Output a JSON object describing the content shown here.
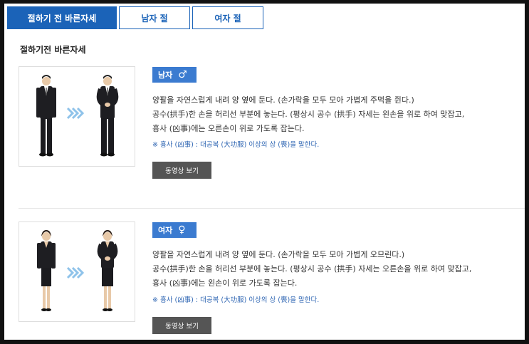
{
  "tabs": [
    {
      "label": "절하기 전 바른자세",
      "active": true
    },
    {
      "label": "남자 절",
      "active": false
    },
    {
      "label": "여자 절",
      "active": false
    }
  ],
  "section_title": "절하기전 바른자세",
  "man": {
    "badge_label": "남자",
    "badge_icon": "male-symbol",
    "lines": [
      "양팔을 자연스럽게 내려 양 옆에 둔다. (손가락을 모두 모아 가볍게 주먹을 쥔다.)",
      "공수(拱手)한 손을 허리선 부분에 놓는다. (평상시 공수 (拱手) 자세는 왼손을 위로 하여 맞잡고,",
      "흉사 (凶事)에는 오른손이 위로 가도록 잡는다."
    ],
    "note": "※ 흉사 (凶事) : 대공복 (大功服) 이상의 상 (喪)을 말한다.",
    "video_label": "동영상 보기"
  },
  "woman": {
    "badge_label": "여자",
    "badge_icon": "female-symbol",
    "lines": [
      "양팔을 자연스럽게 내려 양 옆에 둔다. (손가락을 모두 모아 가볍게 오므린다.)",
      "공수(拱手)한 손을 허리선 부분에 놓는다. (평상시 공수 (拱手) 자세는 오른손을 위로 하여 맞잡고,",
      "흉사 (凶事)에는 왼손이 위로 가도록 잡는다."
    ],
    "note": "※ 흉사 (凶事) : 대공복 (大功服) 이상의 상 (喪)을 말한다.",
    "video_label": "동영상 보기"
  },
  "colors": {
    "accent": "#1b63b8",
    "badge": "#3b7bd0",
    "button": "#555555",
    "note": "#2f66b3",
    "arrow": "#8fc3ea"
  }
}
